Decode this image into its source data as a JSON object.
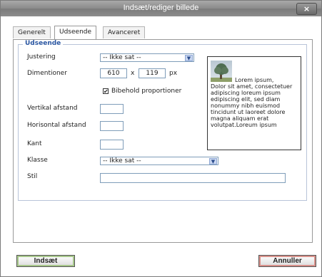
{
  "dialog": {
    "title": "Indsæt/rediger billede",
    "close_label": "×"
  },
  "tabs": [
    {
      "label": "Generelt",
      "active": false
    },
    {
      "label": "Udseende",
      "active": true
    },
    {
      "label": "Avanceret",
      "active": false
    }
  ],
  "appearance": {
    "legend": "Udseende",
    "align_label": "Justering",
    "align_value": "-- Ikke sat --",
    "dimensions_label": "Dimentioner",
    "width_value": "610",
    "times": "x",
    "height_value": "119",
    "unit": "px",
    "keep_proportions_label": "Bibehold proportioner",
    "keep_proportions_checked": true,
    "vspace_label": "Vertikal afstand",
    "vspace_value": "",
    "hspace_label": "Horisontal afstand",
    "hspace_value": "",
    "border_label": "Kant",
    "border_value": "",
    "class_label": "Klasse",
    "class_value": "-- Ikke sat --",
    "style_label": "Stil",
    "style_value": ""
  },
  "preview": {
    "text_first": "Lorem ipsum,",
    "text_rest": "Dolor sit amet, consectetuer adipiscing loreum ipsum edipiscing elit, sed diam nonummy nibh euismod tincidunt ut laoreet dolore magna aliquam erat volutpat.Loreum ipsum"
  },
  "buttons": {
    "insert": "Indsæt",
    "cancel": "Annuller"
  },
  "colors": {
    "legend": "#2b57a2",
    "insert_border": "#a8c88c",
    "cancel_border": "#d9928c"
  }
}
